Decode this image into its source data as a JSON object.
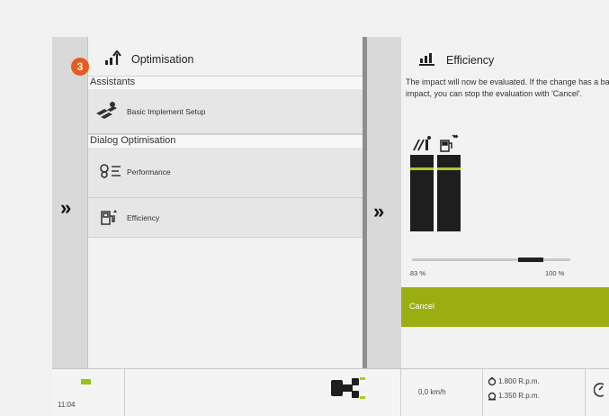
{
  "badge": {
    "number": "3",
    "color": "#ea5a1e"
  },
  "left_panel": {
    "title": "Optimisation",
    "title_icon": "optimisation-arrow-icon",
    "sections": [
      {
        "header": "Assistants",
        "items": [
          {
            "label": "Basic Implement Setup",
            "icon": "implement-setup-icon"
          }
        ]
      },
      {
        "header": "Dialog Optimisation",
        "items": [
          {
            "label": "Performance",
            "icon": "performance-gears-icon"
          },
          {
            "label": "Efficiency",
            "icon": "efficiency-fuel-icon"
          }
        ]
      }
    ],
    "expand_icon": "double-chevron-right-icon"
  },
  "right_panel": {
    "title": "Efficiency",
    "title_icon": "efficiency-chart-icon",
    "message": "The impact will now be evaluated. If the change has a bad impact, you can stop the evaluation with 'Cancel'.",
    "meters": [
      {
        "icon": "fuel-pump-icon",
        "level": 0.83
      },
      {
        "icon": "throughput-icon",
        "level": 0.83
      }
    ],
    "progress": {
      "start_label": "83 %",
      "end_label": "100 %",
      "value": 0.83
    },
    "cancel_label": "Cancel",
    "accent_color": "#9aae12"
  },
  "status_bar": {
    "time": "11:04",
    "speed": "0,0 km/h",
    "rpm_1": "1.800 R.p.m.",
    "rpm_2": "1.350 R.p.m."
  }
}
